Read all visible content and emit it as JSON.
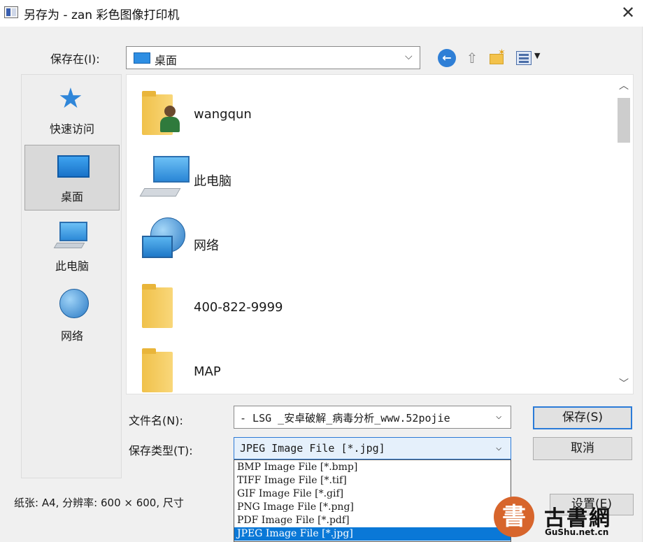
{
  "window": {
    "title": "另存为 - zan 彩色图像打印机",
    "close_glyph": "✕"
  },
  "save_in": {
    "label": "保存在(I):",
    "value": "桌面"
  },
  "toolbar": {
    "icons": [
      "back-icon",
      "up-folder-icon",
      "new-folder-icon",
      "view-menu-icon"
    ]
  },
  "places": [
    {
      "label": "快速访问",
      "icon": "star-icon"
    },
    {
      "label": "桌面",
      "icon": "desktop-icon",
      "selected": true
    },
    {
      "label": "此电脑",
      "icon": "computer-icon"
    },
    {
      "label": "网络",
      "icon": "network-icon"
    }
  ],
  "files": [
    {
      "name": "wangqun",
      "icon": "user-folder-icon"
    },
    {
      "name": "此电脑",
      "icon": "computer-icon"
    },
    {
      "name": "网络",
      "icon": "network-icon"
    },
    {
      "name": "400-822-9999",
      "icon": "folder-icon"
    },
    {
      "name": "MAP",
      "icon": "folder-icon"
    }
  ],
  "filename": {
    "label": "文件名(N):",
    "value": "- LSG _安卓破解_病毒分析_www.52pojie"
  },
  "filetype": {
    "label": "保存类型(T):",
    "value": "JPEG Image File [*.jpg]",
    "options": [
      "BMP Image File [*.bmp]",
      "TIFF Image File [*.tif]",
      "GIF Image File [*.gif]",
      "PNG Image File [*.png]",
      "PDF Image File [*.pdf]",
      "JPEG Image File [*.jpg]"
    ],
    "selected_index": 5
  },
  "buttons": {
    "save": "保存(S)",
    "cancel": "取消",
    "setup": "设置(E)"
  },
  "paper_info": "纸张: A4, 分辨率: 600 × 600, 尺寸",
  "watermark": {
    "seal": "書",
    "name": "古書網",
    "url": "GuShu.net.cn"
  },
  "colors": {
    "accent": "#0a78d7",
    "dialog_bg": "#f0f0f0",
    "seal": "#d7652c"
  }
}
